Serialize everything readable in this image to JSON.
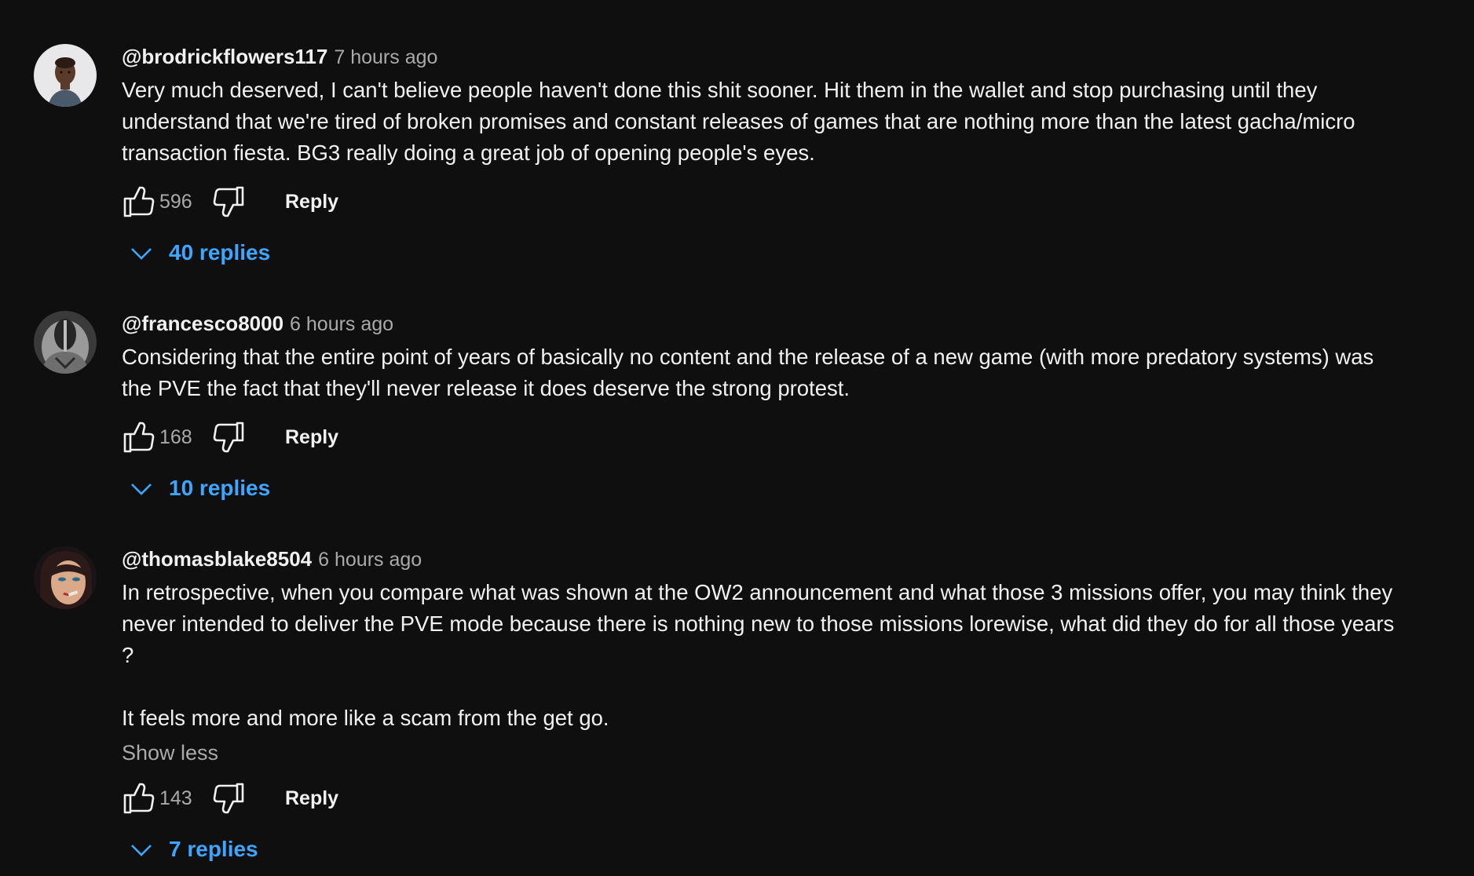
{
  "comments": [
    {
      "author": "@brodrickflowers117",
      "time": "7 hours ago",
      "paragraphs": [
        "Very much deserved, I can't believe people haven't done this shit sooner. Hit them in the wallet and stop purchasing until they understand that we're tired of broken promises and constant releases of games that are nothing more than the latest gacha/micro transaction fiesta. BG3 really doing a great job of opening people's eyes."
      ],
      "likes": "596",
      "reply_label": "Reply",
      "replies_label": "40 replies"
    },
    {
      "author": "@francesco8000",
      "time": "6 hours ago",
      "paragraphs": [
        "Considering that the entire point of years of basically no content and the release of a new game (with more predatory systems) was the PVE the fact that they'll never release it does deserve the strong protest."
      ],
      "likes": "168",
      "reply_label": "Reply",
      "replies_label": "10 replies"
    },
    {
      "author": "@thomasblake8504",
      "time": "6 hours ago",
      "paragraphs": [
        "In retrospective, when you compare what was shown at the OW2 announcement and what those 3 missions offer, you may think they never intended to deliver the PVE mode because there is nothing new to those missions lorewise, what did they do for all those years ?",
        "It feels more and more like a scam from the get go."
      ],
      "show_less": "Show less",
      "likes": "143",
      "reply_label": "Reply",
      "replies_label": "7 replies"
    }
  ],
  "colors": {
    "background": "#0f0f0f",
    "text": "#f1f1f1",
    "secondary": "#aaaaaa",
    "link": "#3ea6ff"
  },
  "icons": {
    "like": "thumbs-up-icon",
    "dislike": "thumbs-down-icon",
    "expand": "chevron-down-icon"
  }
}
